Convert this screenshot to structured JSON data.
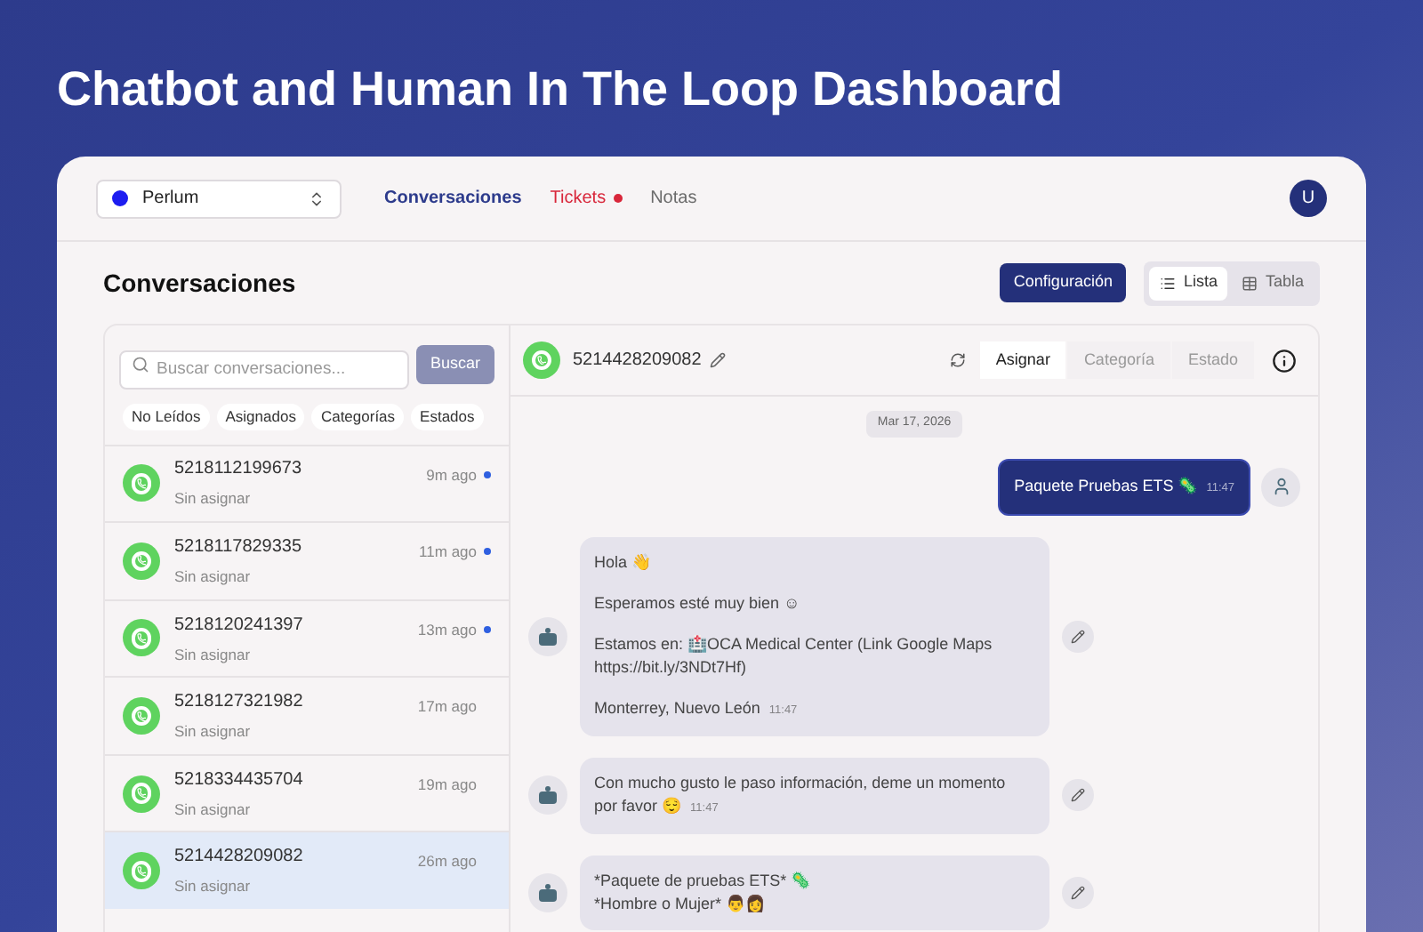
{
  "headline": "Chatbot and Human In The Loop Dashboard",
  "workspace": {
    "label": "Perlum",
    "color": "#1d1df0"
  },
  "nav": [
    {
      "label": "Conversaciones",
      "selected": true,
      "alert": false
    },
    {
      "label": "Tickets",
      "selected": false,
      "alert": true
    },
    {
      "label": "Notas",
      "selected": false,
      "alert": false
    }
  ],
  "user_avatar": "U",
  "page_title": "Conversaciones",
  "config_button": "Configuración",
  "views": [
    {
      "label": "Lista",
      "kind": "list",
      "selected": true
    },
    {
      "label": "Tabla",
      "kind": "table",
      "selected": false
    }
  ],
  "search": {
    "placeholder": "Buscar conversaciones...",
    "button": "Buscar"
  },
  "filters": [
    "No Leídos",
    "Asignados",
    "Categorías",
    "Estados"
  ],
  "conversations": [
    {
      "phone": "5218112199673",
      "status": "Sin asignar",
      "time": "9m ago",
      "unread": true,
      "selected": false
    },
    {
      "phone": "5218117829335",
      "status": "Sin asignar",
      "time": "11m ago",
      "unread": true,
      "selected": false
    },
    {
      "phone": "5218120241397",
      "status": "Sin asignar",
      "time": "13m ago",
      "unread": true,
      "selected": false
    },
    {
      "phone": "5218127321982",
      "status": "Sin asignar",
      "time": "17m ago",
      "unread": false,
      "selected": false
    },
    {
      "phone": "5218334435704",
      "status": "Sin asignar",
      "time": "19m ago",
      "unread": false,
      "selected": false
    },
    {
      "phone": "5214428209082",
      "status": "Sin asignar",
      "time": "26m ago",
      "unread": false,
      "selected": true
    }
  ],
  "chat": {
    "phone": "5214428209082",
    "actions": [
      {
        "label": "Asignar",
        "selected": true
      },
      {
        "label": "Categoría",
        "selected": false
      },
      {
        "label": "Estado",
        "selected": false
      }
    ],
    "date": "Mar 17, 2026",
    "messages": [
      {
        "kind": "outgoing",
        "paragraphs": [
          [
            "Paquete Pruebas ETS 🦠"
          ]
        ],
        "time": "11:47"
      },
      {
        "kind": "incoming",
        "paragraphs": [
          [
            "Hola 👋"
          ],
          [
            "Esperamos esté muy bien ☺"
          ],
          [
            "Estamos en: 🏥OCA Medical Center (Link Google Maps",
            "https://bit.ly/3NDt7Hf)"
          ],
          [
            "Monterrey, Nuevo León"
          ]
        ],
        "time": "11:47"
      },
      {
        "kind": "incoming",
        "paragraphs": [
          [
            "Con mucho gusto le paso información, deme un momento",
            "por favor 😌"
          ]
        ],
        "time": "11:47"
      },
      {
        "kind": "incoming",
        "paragraphs": [
          [
            "*Paquete de pruebas ETS* 🦠",
            "*Hombre o Mujer* 👨👩"
          ]
        ]
      }
    ]
  }
}
